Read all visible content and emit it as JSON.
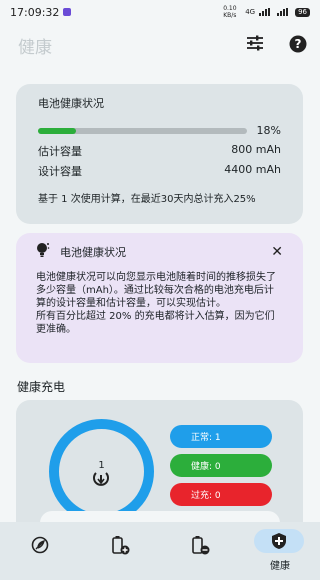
{
  "status_bar": {
    "time": "17:09:32",
    "net_speed": "0.10 KB/s",
    "net_type": "4G",
    "battery": "96"
  },
  "header": {
    "title": "健康",
    "settings_icon": "sliders-icon",
    "help_icon": "help-icon"
  },
  "battery_health": {
    "title": "电池健康状况",
    "health_percent": 18,
    "health_label": "18%",
    "estimated_label": "估计容量",
    "estimated_value": "800 mAh",
    "design_label": "设计容量",
    "design_value": "4400 mAh",
    "note": "基于 1 次使用计算，在最近30天内总计充入25%"
  },
  "info_card": {
    "title": "电池健康状况",
    "close_label": "✕",
    "body": "电池健康状况可以向您显示电池随着时间的推移损失了多少容量（mAh）。通过比较每次合格的电池充电后计算的设计容量和估计容量，可以实现估计。\n所有百分比超过 20% 的充电都将计入估算，因为它们更准确。"
  },
  "healthy_charging": {
    "section_title": "健康充电",
    "total_count": "1",
    "pills": [
      {
        "label": "正常: 1",
        "color": "#1f9eea"
      },
      {
        "label": "健康: 0",
        "color": "#2cae3b"
      },
      {
        "label": "过充: 0",
        "color": "#e8242c"
      }
    ]
  },
  "nav": {
    "items": [
      {
        "icon": "leaf-icon",
        "label": ""
      },
      {
        "icon": "battery-plus-icon",
        "label": ""
      },
      {
        "icon": "battery-minus-icon",
        "label": ""
      },
      {
        "icon": "shield-icon",
        "label": "健康",
        "active": true
      }
    ]
  },
  "colors": {
    "accent_blue": "#1f9eea",
    "green": "#2cae3b",
    "red": "#e8242c",
    "card_bg": "#dde4e7",
    "info_bg": "#ebe3f6"
  }
}
